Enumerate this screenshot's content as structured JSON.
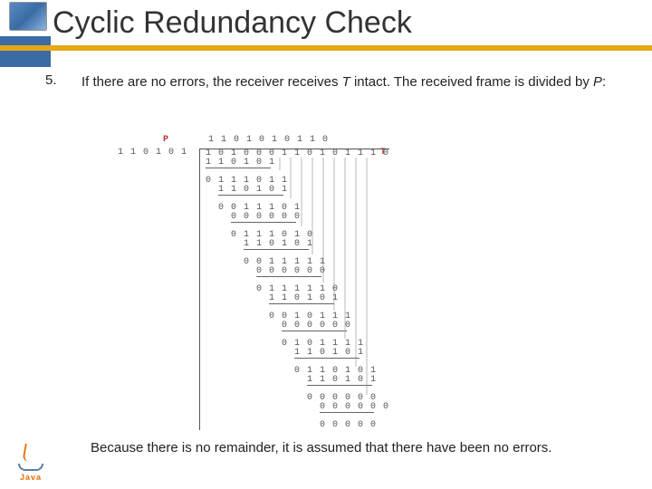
{
  "header": {
    "title": "Cyclic Redundancy Check"
  },
  "step": {
    "number": "5.",
    "text_prefix": "If there are no errors, the receiver receives ",
    "t_var": "T",
    "text_mid": " intact. The received frame is divided by ",
    "p_var": "P",
    "text_suffix": ":"
  },
  "labels": {
    "p": "P",
    "t": "T"
  },
  "division": {
    "divisor": "1 1 0 1 0 1",
    "quotient": "1 1 0 1 0 1 0 1 1 0",
    "dividend": "1 0 1 0 0 0 1 1 0 1 0 1 1 1 0",
    "steps": [
      "1 1 0 1 0 1",
      "0 1 1 1 0 1 1",
      "  1 1 0 1 0 1",
      "  0 0 1 1 1 0 1",
      "    0 0 0 0 0 0",
      "    0 1 1 1 0 1 0",
      "      1 1 0 1 0 1",
      "      0 0 1 1 1 1 1",
      "        0 0 0 0 0 0",
      "        0 1 1 1 1 1 0",
      "          1 1 0 1 0 1",
      "          0 0 1 0 1 1 1",
      "            0 0 0 0 0 0",
      "            0 1 0 1 1 1 1",
      "              1 1 0 1 0 1",
      "              0 1 1 0 1 0 1",
      "                1 1 0 1 0 1",
      "                0 0 0 0 0 0",
      "                  0 0 0 0 0 0",
      "                  0 0 0 0 0"
    ]
  },
  "conclusion": "Because there is no remainder, it is assumed that there have been no errors.",
  "java": {
    "text": "Java"
  }
}
